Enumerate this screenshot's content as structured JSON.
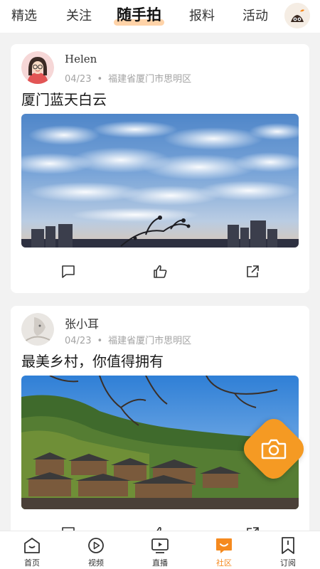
{
  "top_tabs": [
    {
      "label": "精选"
    },
    {
      "label": "关注"
    },
    {
      "label": "随手拍"
    },
    {
      "label": "报料"
    },
    {
      "label": "活动"
    }
  ],
  "active_tab": "随手拍",
  "posts": [
    {
      "username": "Helen",
      "date": "04/23",
      "separator": "•",
      "location": "福建省厦门市思明区",
      "title": "厦门蓝天白云"
    },
    {
      "username": "张小耳",
      "date": "04/23",
      "separator": "•",
      "location": "福建省厦门市思明区",
      "title": "最美乡村，你值得拥有"
    }
  ],
  "bottom_nav": [
    {
      "label": "首页",
      "icon": "home-icon"
    },
    {
      "label": "视频",
      "icon": "play-icon"
    },
    {
      "label": "直播",
      "icon": "tv-icon"
    },
    {
      "label": "社区",
      "icon": "community-icon"
    },
    {
      "label": "订阅",
      "icon": "bookmark-icon"
    }
  ],
  "active_nav": "社区",
  "colors": {
    "accent": "#f58a1f",
    "tab_highlight": "#ffd3a8",
    "background": "#f2f2f2",
    "meta_text": "#a3a3a3"
  }
}
